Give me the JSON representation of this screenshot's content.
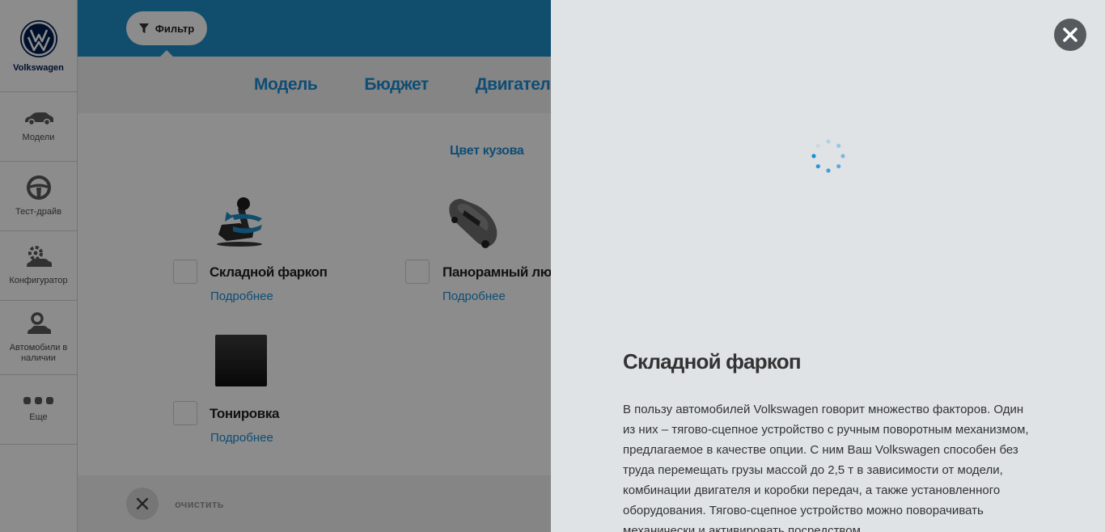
{
  "sidebar": {
    "brand": "Volkswagen",
    "items": [
      {
        "label": "Модели",
        "icon": "car-icon"
      },
      {
        "label": "Тест-драйв",
        "icon": "steering-wheel-icon"
      },
      {
        "label": "Конфигуратор",
        "icon": "configurator-icon"
      },
      {
        "label": "Автомобили в наличии",
        "icon": "cars-in-stock-icon"
      },
      {
        "label": "Еще",
        "icon": "more-dots-icon"
      }
    ]
  },
  "toolbar": {
    "filter_label": "Фильтр"
  },
  "tabs": [
    "Модель",
    "Бюджет",
    "Двигатель"
  ],
  "section_title": "Цвет кузова",
  "options": [
    {
      "title": "Складной фаркоп",
      "link": "Подробнее"
    },
    {
      "title": "Панорамный люк",
      "link": "Подробнее"
    },
    {
      "title": "Тонировка",
      "link": "Подробнее"
    }
  ],
  "footer": {
    "clear_label": "очистить"
  },
  "panel": {
    "title": "Складной фаркоп",
    "body": "В пользу автомобилей Volkswagen говорит множество факторов. Один из них – тягово-сцепное устройство с ручным поворотным механизмом, предлагаемое в качестве опции. С ним Ваш Volkswagen способен без труда перемещать грузы массой до 2,5 т в зависимости от модели, комбинации двигателя и коробки передач, а также установленного оборудования. Тягово-сцепное устройство можно поворачивать механически и активировать посредством"
  },
  "colors": {
    "accent": "#1c8cd4",
    "topbar": "#1f8fc9",
    "panel_bg": "#dfe3e6",
    "brand": "#001e50"
  }
}
